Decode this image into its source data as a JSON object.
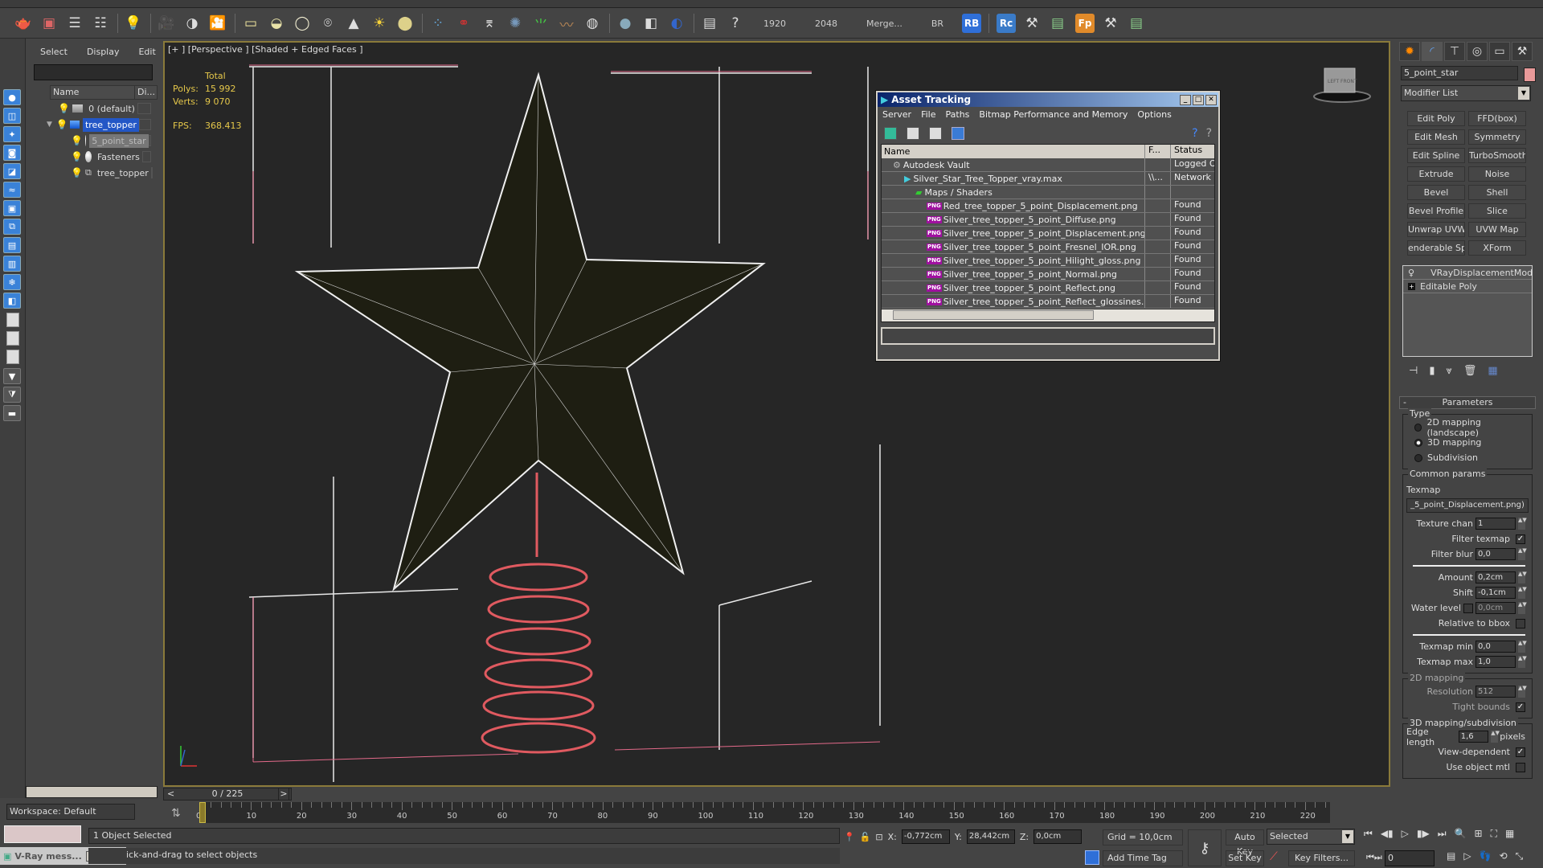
{
  "toolbar": {
    "icons": [
      "teapot-icon",
      "render-frame-icon",
      "render-setup-icon",
      "render-settings-icon",
      "light-list-icon",
      "camera-icon",
      "camera-target-icon",
      "camera-physical-icon",
      "plane-light-icon",
      "dome-light-icon",
      "sphere-light-icon",
      "ies-light-icon",
      "cone-icon",
      "sun-icon",
      "sphere-icon",
      "fur-icon",
      "molecule-icon",
      "tower-icon",
      "rock-icon",
      "grass-icon",
      "hair-icon",
      "ox-icon",
      "vray-sphere-icon",
      "vray-material-icon",
      "vray-frame-buffer-icon",
      "layer-manager-icon",
      "help-icon"
    ],
    "resolution_width": "1920",
    "resolution_height": "2048",
    "merge_label": "Merge...",
    "br_label": "BR",
    "badges": [
      {
        "text": "RB",
        "color": "#2f6fd8"
      },
      {
        "text": "Rc",
        "color": "#3a7bc8"
      },
      {
        "text": "Fp",
        "color": "#e08a2a"
      }
    ]
  },
  "explorer": {
    "menu": [
      "Select",
      "Display",
      "Edit"
    ],
    "search_value": "",
    "columns": [
      "Name",
      "Di..."
    ],
    "items": [
      {
        "label": "0 (default)",
        "type": "layer",
        "level": 0,
        "state": "normal"
      },
      {
        "label": "tree_topper",
        "type": "layer-active",
        "level": 0,
        "state": "selected",
        "expanded": true
      },
      {
        "label": "5_point_star",
        "type": "object",
        "level": 1,
        "state": "dim"
      },
      {
        "label": "Fasteners",
        "type": "object",
        "level": 1,
        "state": "normal"
      },
      {
        "label": "tree_topper",
        "type": "group",
        "level": 1,
        "state": "normal"
      }
    ],
    "workspace": "Workspace: Default"
  },
  "viewport": {
    "label": "[+ ] [Perspective ] [Shaded + Edged Faces ]",
    "stats": {
      "header": "Total",
      "polys_label": "Polys:",
      "polys": "15 992",
      "verts_label": "Verts:",
      "verts": "9 070",
      "fps_label": "FPS:",
      "fps": "368.413"
    },
    "viewcube_labels": [
      "LEFT",
      "FRONT"
    ]
  },
  "timeline": {
    "frame_display": "0 / 225",
    "current_frame": 0,
    "total_frames": 225,
    "ticks": [
      0,
      10,
      20,
      30,
      40,
      50,
      60,
      70,
      80,
      90,
      100,
      110,
      120,
      130,
      140,
      150,
      160,
      170,
      180,
      190,
      200,
      210,
      220
    ]
  },
  "asset_tracking": {
    "title": "Asset Tracking",
    "menu": [
      "Server",
      "File",
      "Paths",
      "Bitmap Performance and Memory",
      "Options"
    ],
    "columns": [
      "Name",
      "F...",
      "Status"
    ],
    "rows": [
      {
        "name": "Autodesk Vault",
        "indent": 1,
        "icon": "vault",
        "path": "",
        "status": "Logged O"
      },
      {
        "name": "Silver_Star_Tree_Topper_vray.max",
        "indent": 2,
        "icon": "max",
        "path": "\\\\...",
        "status": "Network F"
      },
      {
        "name": "Maps / Shaders",
        "indent": 3,
        "icon": "maps",
        "path": "",
        "status": ""
      },
      {
        "name": "Red_tree_topper_5_point_Displacement.png",
        "indent": 4,
        "icon": "png",
        "path": "",
        "status": "Found"
      },
      {
        "name": "Silver_tree_topper_5_point_Diffuse.png",
        "indent": 4,
        "icon": "png",
        "path": "",
        "status": "Found"
      },
      {
        "name": "Silver_tree_topper_5_point_Displacement.png",
        "indent": 4,
        "icon": "png",
        "path": "",
        "status": "Found"
      },
      {
        "name": "Silver_tree_topper_5_point_Fresnel_IOR.png",
        "indent": 4,
        "icon": "png",
        "path": "",
        "status": "Found"
      },
      {
        "name": "Silver_tree_topper_5_point_Hilight_gloss.png",
        "indent": 4,
        "icon": "png",
        "path": "",
        "status": "Found"
      },
      {
        "name": "Silver_tree_topper_5_point_Normal.png",
        "indent": 4,
        "icon": "png",
        "path": "",
        "status": "Found"
      },
      {
        "name": "Silver_tree_topper_5_point_Reflect.png",
        "indent": 4,
        "icon": "png",
        "path": "",
        "status": "Found"
      },
      {
        "name": "Silver_tree_topper_5_point_Reflect_glossines....",
        "indent": 4,
        "icon": "png",
        "path": "",
        "status": "Found"
      }
    ]
  },
  "command_panel": {
    "object_name": "5_point_star",
    "object_color": "#e89999",
    "modifier_list": "Modifier List",
    "modifier_buttons": [
      "Edit Poly",
      "FFD(box)",
      "Edit Mesh",
      "Symmetry",
      "Edit Spline",
      "TurboSmooth",
      "Extrude",
      "Noise",
      "Bevel",
      "Shell",
      "Bevel Profile",
      "Slice",
      "Unwrap UVW",
      "UVW Map",
      "enderable Splin",
      "XForm"
    ],
    "stack": [
      "VRayDisplacementMod",
      "Editable Poly"
    ],
    "parameters": {
      "title": "Parameters",
      "type_group": "Type",
      "type_options": [
        "2D mapping (landscape)",
        "3D mapping",
        "Subdivision"
      ],
      "type_selected": "3D mapping",
      "common_group": "Common params",
      "texmap_label": "Texmap",
      "texmap_value": "_5_point_Displacement.png)",
      "texture_chan_label": "Texture chan",
      "texture_chan": "1",
      "filter_texmap_label": "Filter texmap",
      "filter_texmap": true,
      "filter_blur_label": "Filter blur",
      "filter_blur": "0,0",
      "amount_label": "Amount",
      "amount": "0,2cm",
      "shift_label": "Shift",
      "shift": "-0,1cm",
      "water_level_label": "Water level",
      "water_level_enabled": false,
      "water_level": "0,0cm",
      "relative_bbox_label": "Relative to bbox",
      "relative_bbox": false,
      "texmap_min_label": "Texmap min",
      "texmap_min": "0,0",
      "texmap_max_label": "Texmap max",
      "texmap_max": "1,0",
      "mapping2d_group": "2D mapping",
      "resolution_label": "Resolution",
      "resolution": "512",
      "tight_bounds_label": "Tight bounds",
      "tight_bounds": true,
      "mapping3d_group": "3D mapping/subdivision",
      "edge_length_label": "Edge length",
      "edge_length": "1,6",
      "edge_length_unit": "pixels",
      "view_dependent_label": "View-dependent",
      "view_dependent": true,
      "use_object_mtl_label": "Use object mtl",
      "use_object_mtl": false
    }
  },
  "status": {
    "selection": "1 Object Selected",
    "prompt": "ick-and-drag to select objects",
    "vray_window": "V-Ray mess...",
    "x_label": "X:",
    "x": "-0,772cm",
    "y_label": "Y:",
    "y": "28,442cm",
    "z_label": "Z:",
    "z": "0,0cm",
    "grid": "Grid = 10,0cm",
    "add_time_tag": "Add Time Tag",
    "auto_key": "Auto Key",
    "set_key": "Set Key",
    "key_mode": "Selected",
    "key_filters": "Key Filters...",
    "frame": "0"
  }
}
